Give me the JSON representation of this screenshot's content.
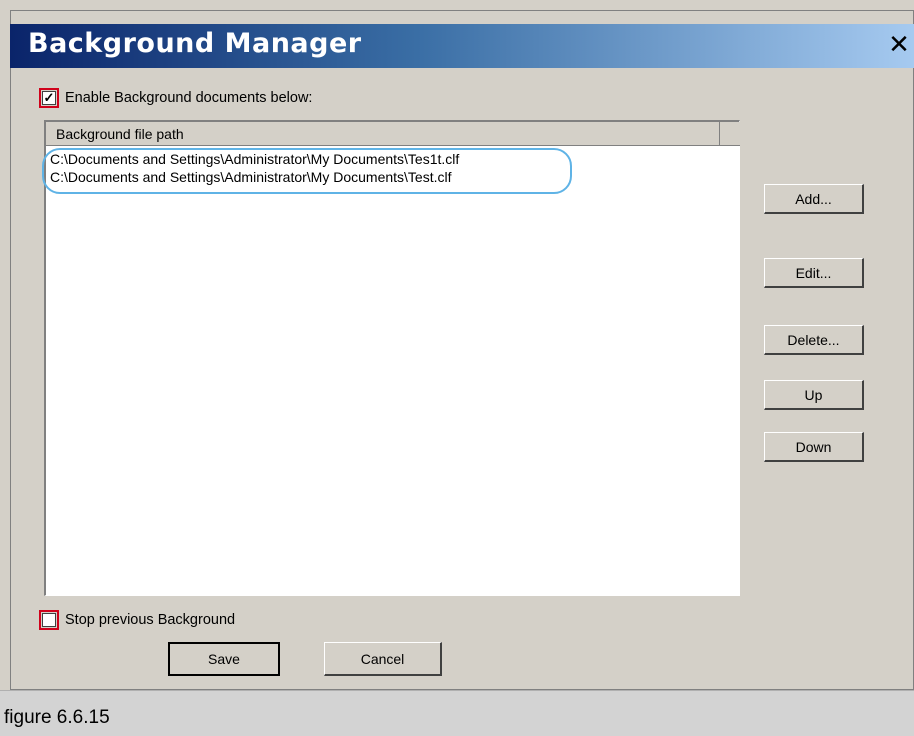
{
  "window": {
    "title": "Background Manager",
    "close_symbol": "✕"
  },
  "enable_checkbox": {
    "label": "Enable Background documents below:",
    "checked": true,
    "mark": "✓"
  },
  "list": {
    "column_header": "Background file path",
    "rows": [
      "C:\\Documents and Settings\\Administrator\\My Documents\\Tes1t.clf",
      "C:\\Documents and Settings\\Administrator\\My Documents\\Test.clf"
    ]
  },
  "side_buttons": {
    "add": "Add...",
    "edit": "Edit...",
    "delete": "Delete...",
    "up": "Up",
    "down": "Down"
  },
  "stop_checkbox": {
    "label": "Stop previous Background",
    "checked": false
  },
  "bottom_buttons": {
    "save": "Save",
    "cancel": "Cancel"
  },
  "caption": "figure 6.6.15",
  "colors": {
    "title_gradient_start": "#0a246a",
    "highlight": "#5fb3e6",
    "checkbox_outline": "#d0021b"
  }
}
